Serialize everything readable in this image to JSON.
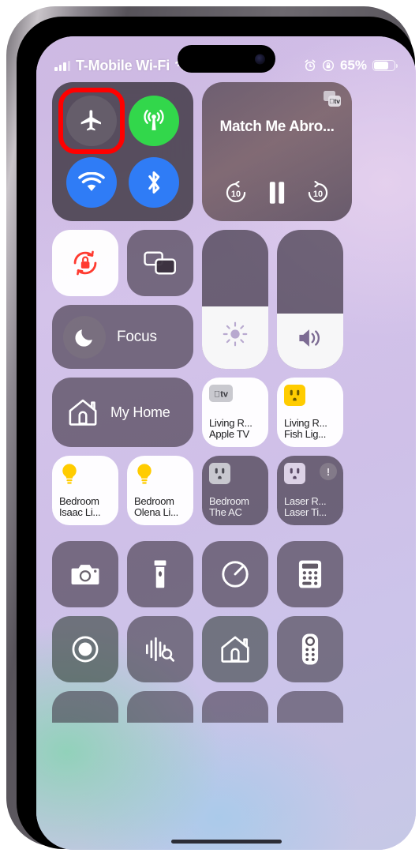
{
  "status_bar": {
    "carrier": "T-Mobile Wi-Fi",
    "signal_icon": "cellular-bars-icon",
    "wifi_icon": "wifi-icon",
    "alarm_icon": "alarm-clock-icon",
    "rotation_lock_icon": "rotation-lock-icon",
    "battery_percent": "65%",
    "battery_icon": "battery-icon",
    "battery_fill_pct": 65
  },
  "connectivity": {
    "airplane": {
      "label": "Airplane Mode",
      "icon": "airplane-icon",
      "state": "off"
    },
    "cellular": {
      "label": "Cellular Data",
      "icon": "cellular-antenna-icon",
      "state": "on"
    },
    "wifi": {
      "label": "Wi-Fi",
      "icon": "wifi-icon",
      "state": "on"
    },
    "bluetooth": {
      "label": "Bluetooth",
      "icon": "bluetooth-icon",
      "state": "on"
    }
  },
  "highlight": {
    "target": "airplane-mode-button",
    "color": "#ff0000"
  },
  "media": {
    "title": "Match Me Abro...",
    "app_icon": "apple-tv-app-icon",
    "skip_back_label": "10",
    "skip_forward_label": "10",
    "playback_state": "playing",
    "pause_icon": "pause-icon",
    "skip_back_icon": "skip-back-10-icon",
    "skip_forward_icon": "skip-forward-10-icon"
  },
  "display_controls": {
    "rotation_lock": {
      "label": "Rotation Lock",
      "icon": "rotation-lock-icon",
      "state": "on"
    },
    "screen_mirroring": {
      "label": "Screen Mirroring",
      "icon": "screen-mirroring-icon",
      "state": "off"
    },
    "focus": {
      "label": "Focus",
      "icon": "moon-icon",
      "state": "off"
    },
    "brightness": {
      "label": "Brightness",
      "icon": "brightness-icon",
      "value_pct": 45
    },
    "volume": {
      "label": "Volume",
      "icon": "speaker-icon",
      "value_pct": 40
    }
  },
  "home": {
    "my_home_label": "My Home",
    "my_home_icon": "house-icon",
    "accessories": [
      {
        "name": "living-room-apple-tv",
        "line1": "Living R...",
        "line2": "Apple TV",
        "icon": "apple-tv-icon",
        "state": "on",
        "accent": "#9a9aa0"
      },
      {
        "name": "living-room-fish-light",
        "line1": "Living R...",
        "line2": "Fish Lig...",
        "icon": "outlet-icon",
        "state": "on",
        "accent": "#ffcc00"
      },
      {
        "name": "bedroom-isaac-light",
        "line1": "Bedroom",
        "line2": "Isaac Li...",
        "icon": "lightbulb-icon",
        "state": "on",
        "accent": "#ffcc00"
      },
      {
        "name": "bedroom-olena-light",
        "line1": "Bedroom",
        "line2": "Olena Li...",
        "icon": "lightbulb-icon",
        "state": "on",
        "accent": "#ffcc00"
      },
      {
        "name": "bedroom-the-ac",
        "line1": "Bedroom",
        "line2": "The AC",
        "icon": "outlet-icon",
        "state": "off",
        "accent": "#c8c8cf"
      },
      {
        "name": "laser-room-laser-timer",
        "line1": "Laser R...",
        "line2": "Laser Ti...",
        "icon": "outlet-icon",
        "state": "off",
        "accent": "#d8cfe4",
        "badge": "!"
      }
    ]
  },
  "utilities": [
    {
      "name": "camera-button",
      "label": "Camera",
      "icon": "camera-icon"
    },
    {
      "name": "flashlight-button",
      "label": "Flashlight",
      "icon": "flashlight-icon"
    },
    {
      "name": "timer-button",
      "label": "Timer",
      "icon": "timer-icon"
    },
    {
      "name": "calculator-button",
      "label": "Calculator",
      "icon": "calculator-icon"
    },
    {
      "name": "screen-recording-button",
      "label": "Screen Recording",
      "icon": "record-icon"
    },
    {
      "name": "music-recognition-button",
      "label": "Music Recognition",
      "icon": "shazam-waveform-icon"
    },
    {
      "name": "home-app-button",
      "label": "Home",
      "icon": "house-icon"
    },
    {
      "name": "apple-tv-remote-button",
      "label": "Apple TV Remote",
      "icon": "remote-icon"
    }
  ]
}
